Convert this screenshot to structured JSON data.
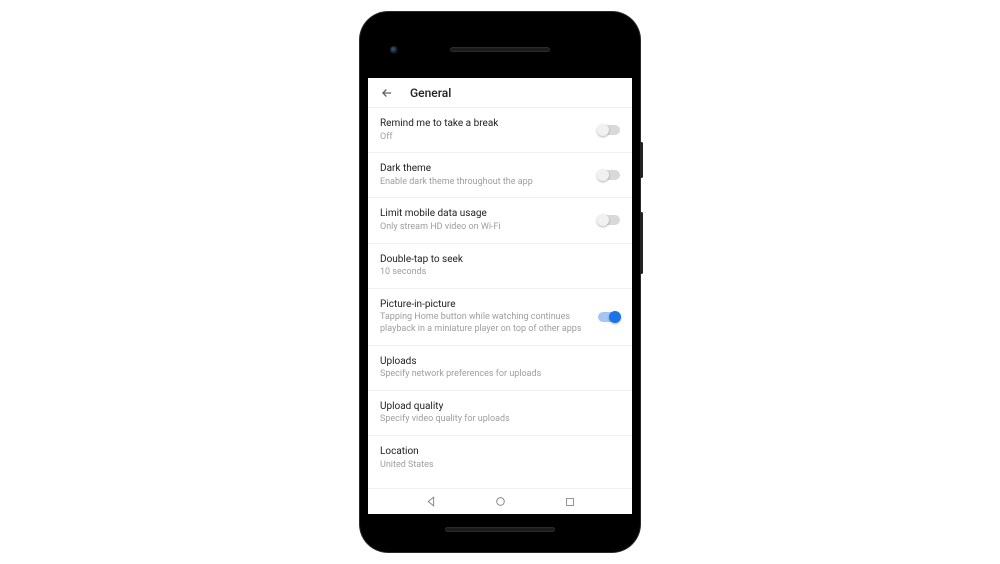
{
  "header": {
    "title": "General"
  },
  "settings": {
    "items": [
      {
        "title": "Remind me to take a break",
        "sub": "Off",
        "toggle": true,
        "on": false
      },
      {
        "title": "Dark theme",
        "sub": "Enable dark theme throughout the app",
        "toggle": true,
        "on": false
      },
      {
        "title": "Limit mobile data usage",
        "sub": "Only stream HD video on Wi-Fi",
        "toggle": true,
        "on": false
      },
      {
        "title": "Double-tap to seek",
        "sub": "10 seconds",
        "toggle": false
      },
      {
        "title": "Picture-in-picture",
        "sub": "Tapping Home button while watching continues playback in a miniature player on top of other apps",
        "toggle": true,
        "on": true
      },
      {
        "title": "Uploads",
        "sub": "Specify network preferences for uploads",
        "toggle": false
      },
      {
        "title": "Upload quality",
        "sub": "Specify video quality for uploads",
        "toggle": false
      },
      {
        "title": "Location",
        "sub": "United States",
        "toggle": false
      }
    ]
  }
}
